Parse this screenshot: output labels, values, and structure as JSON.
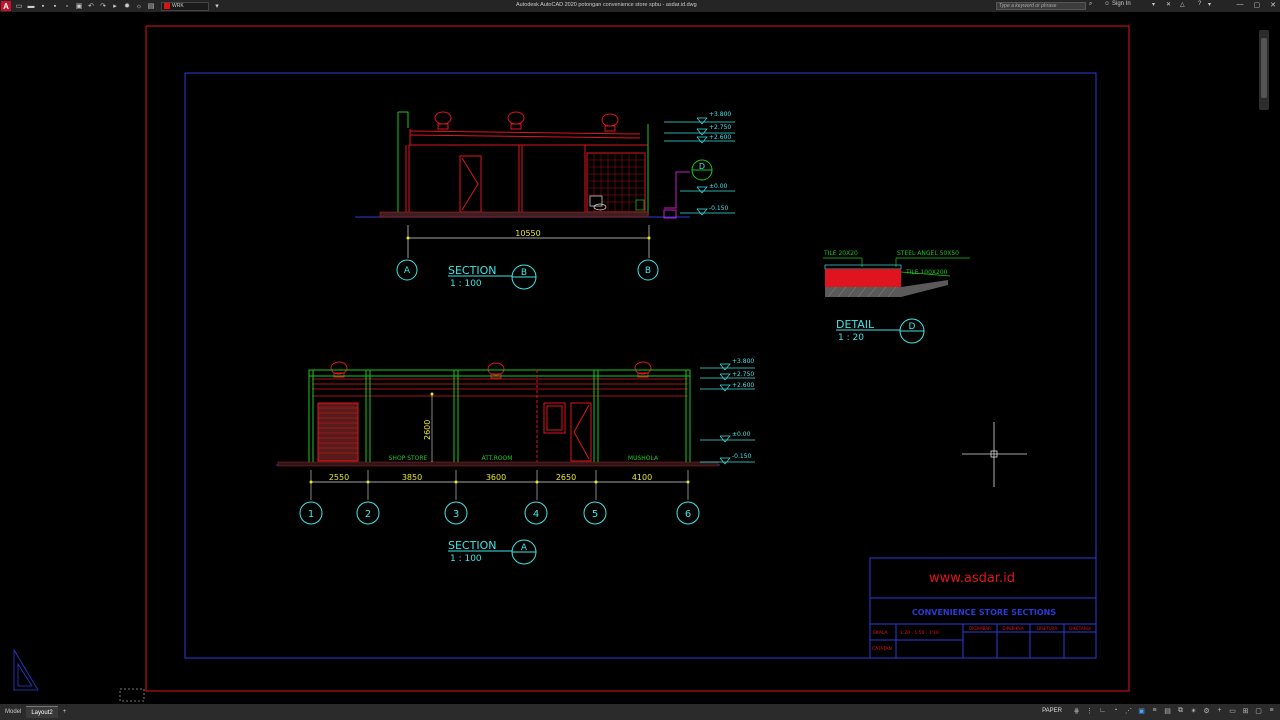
{
  "app": {
    "logo": "A",
    "window_title": "Autodesk AutoCAD 2020   potongan convenience store spbu - asdar.id.dwg",
    "search_placeholder": "Type a keyword or phrase",
    "sign_in": "Sign In",
    "current_layer": "WRK"
  },
  "tabs": [
    {
      "label": "Model"
    },
    {
      "label": "Layout2"
    }
  ],
  "status": {
    "paper": "PAPER"
  },
  "drawing": {
    "section_b": {
      "title": "SECTION",
      "tag": "B",
      "scale": "1 : 100",
      "overall_dim": "10550",
      "grids": [
        "A",
        "B"
      ],
      "levels": [
        "+3.800",
        "+2.750",
        "+2.600",
        "±0.00",
        "-0.150"
      ],
      "detail_ref": "D"
    },
    "section_a": {
      "title": "SECTION",
      "tag": "A",
      "scale": "1 : 100",
      "dims": [
        "2550",
        "3850",
        "3600",
        "2650",
        "4100"
      ],
      "height_dim": "2600",
      "grids": [
        "1",
        "2",
        "3",
        "4",
        "5",
        "6"
      ],
      "rooms": [
        "SHOP STORE",
        "ATT.ROOM",
        "MUSHOLA"
      ],
      "levels": [
        "+3.800",
        "+2.750",
        "+2.600",
        "±0.00",
        "-0.150"
      ]
    },
    "detail_d": {
      "title": "DETAIL",
      "tag": "D",
      "scale": "1 : 20",
      "labels": [
        "TILE 20X20",
        "STEEL ANGEL 50X50",
        "TILE 100X200"
      ]
    },
    "title_block": {
      "website": "www.asdar.id",
      "sheet_title": "CONVENIENCE STORE SECTIONS",
      "scale_label": "SKALA",
      "scale_value": "1:20  ,  1:50  ,  1:10",
      "notes_label": "CATATAN",
      "columns": [
        "DIGAMBAR",
        "DIPERIKSA",
        "DISETUJUI",
        "DIKETAHUI"
      ]
    }
  }
}
